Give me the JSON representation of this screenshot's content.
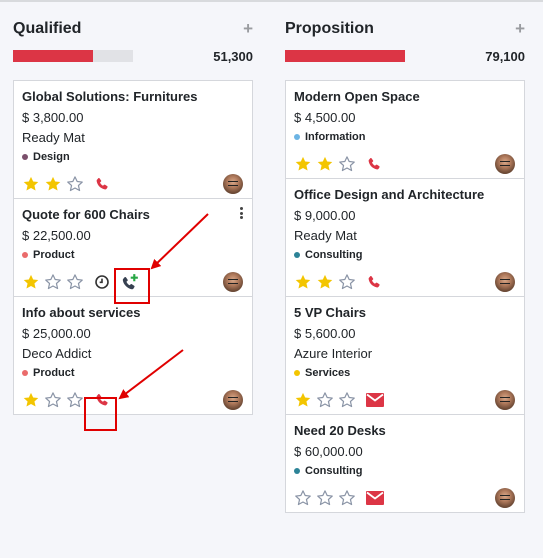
{
  "colors": {
    "accent_red": "#dc3545",
    "star_filled": "#f3c500",
    "star_empty": "#8a94a6",
    "phone_red": "#dc3545",
    "phone_plus_green": "#28a745",
    "annotation_red": "#e00000"
  },
  "columns": [
    {
      "title": "Qualified",
      "add_icon": "plus-icon",
      "total": "51,300",
      "progress_fraction": 0.67,
      "cards": [
        {
          "title": "Global Solutions: Furnitures",
          "amount": "$ 3,800.00",
          "customer": "Ready Mat",
          "tag": "Design",
          "tag_color": "#7b4f6b",
          "stars": 2,
          "activity_icon": "phone-icon",
          "activity_color": "#dc3545"
        },
        {
          "title": "Quote for 600 Chairs",
          "amount": "$ 22,500.00",
          "customer": "",
          "tag": "Product",
          "tag_color": "#ea6b6b",
          "stars": 1,
          "has_clock": true,
          "activity_icon": "phone-plus-icon",
          "activity_color": "#374151",
          "has_menu": true
        },
        {
          "title": "Info about services",
          "amount": "$ 25,000.00",
          "customer": "Deco Addict",
          "tag": "Product",
          "tag_color": "#ea6b6b",
          "stars": 1,
          "activity_icon": "phone-icon",
          "activity_color": "#dc3545"
        }
      ]
    },
    {
      "title": "Proposition",
      "add_icon": "plus-icon",
      "total": "79,100",
      "progress_fraction": 1.0,
      "cards": [
        {
          "title": "Modern Open Space",
          "amount": "$ 4,500.00",
          "customer": "",
          "tag": "Information",
          "tag_color": "#6cb4e4",
          "stars": 2,
          "activity_icon": "phone-icon",
          "activity_color": "#dc3545"
        },
        {
          "title": "Office Design and Architecture",
          "amount": "$ 9,000.00",
          "customer": "Ready Mat",
          "tag": "Consulting",
          "tag_color": "#2c8397",
          "stars": 2,
          "activity_icon": "phone-icon",
          "activity_color": "#dc3545"
        },
        {
          "title": "5 VP Chairs",
          "amount": "$ 5,600.00",
          "customer": "Azure Interior",
          "tag": "Services",
          "tag_color": "#f3c500",
          "stars": 1,
          "activity_icon": "envelope-icon",
          "activity_color": "#dc3545"
        },
        {
          "title": "Need 20 Desks",
          "amount": "$ 60,000.00",
          "customer": "",
          "tag": "Consulting",
          "tag_color": "#2c8397",
          "stars": 0,
          "activity_icon": "envelope-icon",
          "activity_color": "#dc3545"
        }
      ]
    }
  ]
}
